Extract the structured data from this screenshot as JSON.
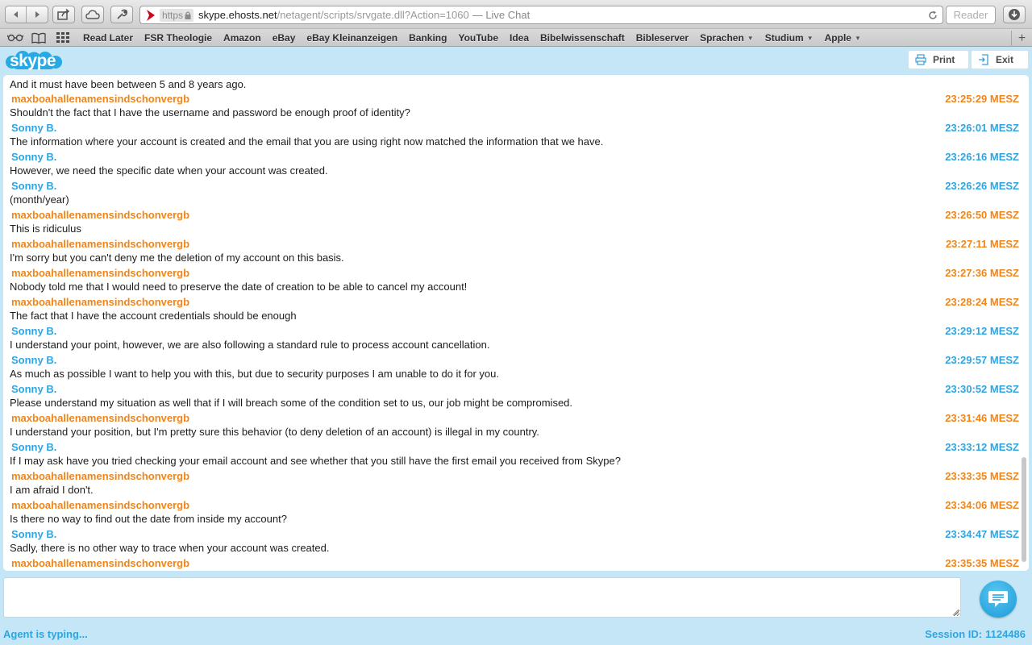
{
  "browser": {
    "url_scheme": "https",
    "url_host": "skype.ehosts.net",
    "url_path": "/netagent/scripts/srvgate.dll?Action=1060",
    "page_title": "— Live Chat",
    "reader_label": "Reader",
    "bookmarks": [
      {
        "label": "Read Later",
        "dropdown": false
      },
      {
        "label": "FSR Theologie",
        "dropdown": false
      },
      {
        "label": "Amazon",
        "dropdown": false
      },
      {
        "label": "eBay",
        "dropdown": false
      },
      {
        "label": "eBay Kleinanzeigen",
        "dropdown": false
      },
      {
        "label": "Banking",
        "dropdown": false
      },
      {
        "label": "YouTube",
        "dropdown": false
      },
      {
        "label": "Idea",
        "dropdown": false
      },
      {
        "label": "Bibelwissenschaft",
        "dropdown": false
      },
      {
        "label": "Bibleserver",
        "dropdown": false
      },
      {
        "label": "Sprachen",
        "dropdown": true
      },
      {
        "label": "Studium",
        "dropdown": true
      },
      {
        "label": "Apple",
        "dropdown": true
      }
    ],
    "new_tab_label": "+"
  },
  "chat": {
    "logo_text": "skype",
    "print_label": "Print",
    "exit_label": "Exit",
    "colors": {
      "user": "#f08519",
      "agent": "#2ea5e0"
    },
    "top_partial_text": "And it must have been between 5 and 8 years ago.",
    "messages": [
      {
        "sender": "maxboahallenamensindschonvergb",
        "role": "user",
        "time": "23:25:29 MESZ",
        "text": "Shouldn't the fact that I have the username and password be enough proof of identity?"
      },
      {
        "sender": "Sonny B.",
        "role": "agent",
        "time": "23:26:01 MESZ",
        "text": "The information where your account is created and the email that you are using right now matched the information that we have."
      },
      {
        "sender": "Sonny B.",
        "role": "agent",
        "time": "23:26:16 MESZ",
        "text": "However, we need the specific date when your account was created."
      },
      {
        "sender": "Sonny B.",
        "role": "agent",
        "time": "23:26:26 MESZ",
        "text": "(month/year)"
      },
      {
        "sender": "maxboahallenamensindschonvergb",
        "role": "user",
        "time": "23:26:50 MESZ",
        "text": "This is ridiculus"
      },
      {
        "sender": "maxboahallenamensindschonvergb",
        "role": "user",
        "time": "23:27:11 MESZ",
        "text": "I'm sorry but you can't deny me the deletion of my account on this basis."
      },
      {
        "sender": "maxboahallenamensindschonvergb",
        "role": "user",
        "time": "23:27:36 MESZ",
        "text": "Nobody told me that I would need to preserve the date of creation to be able to cancel my account!"
      },
      {
        "sender": "maxboahallenamensindschonvergb",
        "role": "user",
        "time": "23:28:24 MESZ",
        "text": "The fact that I have the account credentials should be enough"
      },
      {
        "sender": "Sonny B.",
        "role": "agent",
        "time": "23:29:12 MESZ",
        "text": "I understand your point, however, we are also following a standard rule to process account cancellation."
      },
      {
        "sender": "Sonny B.",
        "role": "agent",
        "time": "23:29:57 MESZ",
        "text": "As much as possible I want to help you with this, but due to security purposes I am unable to do it for you."
      },
      {
        "sender": "Sonny B.",
        "role": "agent",
        "time": "23:30:52 MESZ",
        "text": "Please understand my situation as well that if I will breach some of the condition set to us, our job might be compromised."
      },
      {
        "sender": "maxboahallenamensindschonvergb",
        "role": "user",
        "time": "23:31:46 MESZ",
        "text": "I understand your position, but I'm pretty sure this behavior (to deny deletion of an account) is illegal in my country."
      },
      {
        "sender": "Sonny B.",
        "role": "agent",
        "time": "23:33:12 MESZ",
        "text": "If I may ask have you tried checking your email account and see whether that you still have the first email you received from Skype?"
      },
      {
        "sender": "maxboahallenamensindschonvergb",
        "role": "user",
        "time": "23:33:35 MESZ",
        "text": "I am afraid I don't."
      },
      {
        "sender": "maxboahallenamensindschonvergb",
        "role": "user",
        "time": "23:34:06 MESZ",
        "text": "Is there no way to find out the date from inside my account?"
      },
      {
        "sender": "Sonny B.",
        "role": "agent",
        "time": "23:34:47 MESZ",
        "text": "Sadly, there is no other way to trace when your account was created."
      },
      {
        "sender": "maxboahallenamensindschonvergb",
        "role": "user",
        "time": "23:35:35 MESZ",
        "text": ""
      }
    ],
    "compose_value": "",
    "typing_status": "Agent is typing...",
    "session_label": "Session ID:",
    "session_id": "1124486"
  }
}
